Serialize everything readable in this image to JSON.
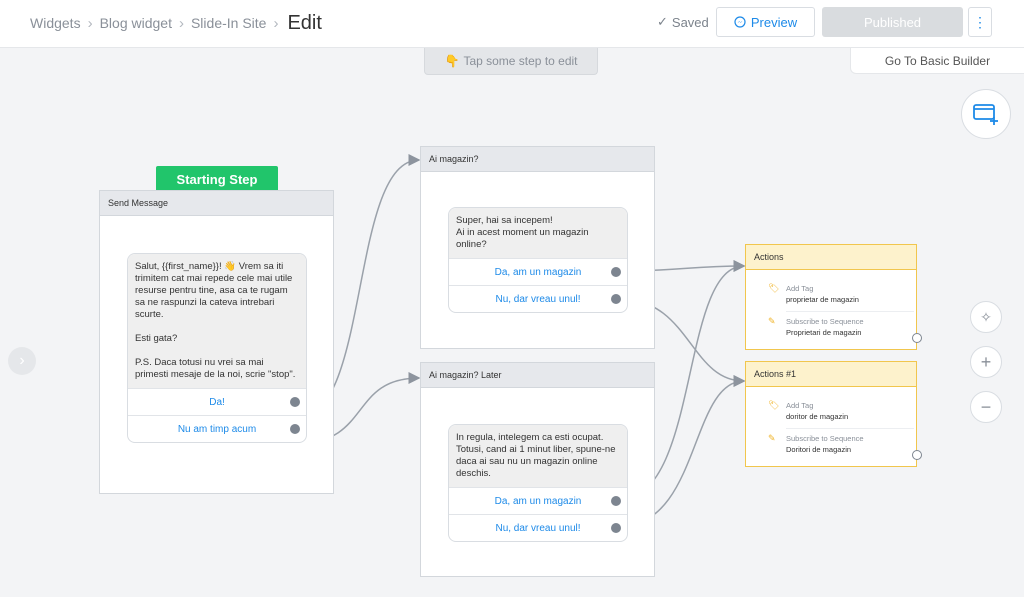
{
  "header": {
    "breadcrumbs": [
      "Widgets",
      "Blog widget",
      "Slide-In Site"
    ],
    "title": "Edit",
    "saved_label": "Saved",
    "preview_label": "Preview",
    "published_label": "Published",
    "more_label": "⋮",
    "basic_builder_label": "Go To Basic Builder"
  },
  "hint": "Tap some step to edit",
  "start_badge": "Starting Step",
  "nodes": {
    "send": {
      "header": "Send Message",
      "text": "Salut, {{first_name}}! 👋 Vrem sa iti trimitem cat mai repede cele mai utile resurse pentru tine, asa ca te rugam sa ne raspunzi la cateva intrebari scurte.\n\nEsti gata?\n\nP.S. Daca totusi nu vrei sa mai primesti mesaje de la noi, scrie \"stop\".",
      "buttons": [
        "Da!",
        "Nu am timp acum"
      ]
    },
    "q1": {
      "header": "Ai magazin?",
      "text": "Super, hai sa incepem!\nAi in acest moment un magazin online?",
      "buttons": [
        "Da, am un magazin",
        "Nu, dar vreau unul!"
      ]
    },
    "q2": {
      "header": "Ai magazin? Later",
      "text": "In regula, intelegem ca esti ocupat. Totusi, cand ai 1 minut liber, spune-ne daca ai sau nu un magazin online deschis.",
      "buttons": [
        "Da, am un magazin",
        "Nu, dar vreau unul!"
      ]
    },
    "actions1": {
      "header": "Actions",
      "items": [
        {
          "label": "Add Tag",
          "value": "proprietar de magazin",
          "icon": "tag-icon"
        },
        {
          "label": "Subscribe to Sequence",
          "value": "Proprietari de magazin",
          "icon": "sequence-icon"
        }
      ]
    },
    "actions2": {
      "header": "Actions #1",
      "items": [
        {
          "label": "Add Tag",
          "value": "doritor de magazin",
          "icon": "tag-icon"
        },
        {
          "label": "Subscribe to Sequence",
          "value": "Doritori de magazin",
          "icon": "sequence-icon"
        }
      ]
    }
  },
  "colors": {
    "accent": "#1d8ae8",
    "start_green": "#21c56b",
    "action_border": "#f1c64d",
    "action_header": "#fdf2cc",
    "wire": "#8d949e"
  }
}
